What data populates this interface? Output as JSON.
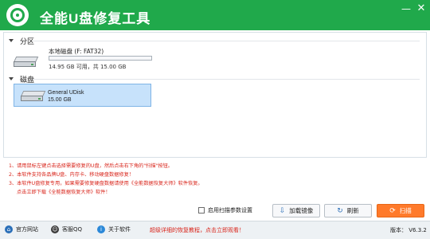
{
  "app": {
    "title": "全能U盘修复工具",
    "minimize_symbol": "—",
    "close_symbol": "✕"
  },
  "partitions": {
    "header": "分区",
    "items": [
      {
        "name": "本地磁盘 (F: FAT32)",
        "used_fraction": 0.0,
        "capacity_text": "14.95 GB 可用，共 15.00 GB"
      }
    ]
  },
  "disks": {
    "header": "磁盘",
    "items": [
      {
        "name": "General UDisk",
        "size": "15.00 GB",
        "selected": true
      }
    ]
  },
  "notes": [
    {
      "text": "1、请用鼠标左键点击选择需要修复的U盘，然后点击右下角的\"扫描\"按钮。"
    },
    {
      "text": "2、本软件支持各品牌U盘、内存卡、移动硬盘数据修复！"
    },
    {
      "text": "3、本软件U盘修复专用，如果需要修复硬盘数据请使用《全能数据恢复大师》软件恢复。"
    },
    {
      "text": "点击立即下载《全能数据恢复大师》软件！"
    }
  ],
  "options": {
    "advanced_scan_label": "启用扫描参数设置",
    "advanced_scan_checked": false
  },
  "buttons": {
    "load_image": "加载镜像",
    "refresh": "刷新",
    "scan": "扫描"
  },
  "footer": {
    "links": [
      {
        "label": "官方网站",
        "icon": "home-icon",
        "color": "#2b6fb8"
      },
      {
        "label": "客服QQ",
        "icon": "qq-icon",
        "color": "#3a3a3a"
      },
      {
        "label": "关于软件",
        "icon": "info-icon",
        "color": "#2b88d8"
      }
    ],
    "promo": "超级详细的恢复教程，点击立即观看！",
    "version": "版本： V6.3.2"
  },
  "colors": {
    "brand_green": "#20a94b",
    "accent_orange": "#ff7a2b",
    "warning_red": "#d9261c",
    "selection_blue": "#c7e2fb"
  }
}
